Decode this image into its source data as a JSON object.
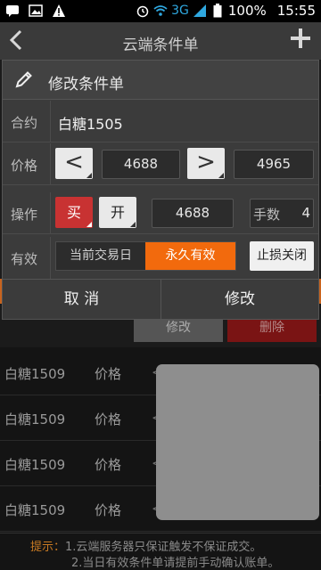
{
  "status_bar": {
    "network": "3G",
    "battery": "100%",
    "time": "15:55"
  },
  "app_bar": {
    "title": "云端条件单"
  },
  "dialog": {
    "title": "修改条件单",
    "contract": {
      "label": "合约",
      "value": "白糖1505"
    },
    "price": {
      "label": "价格",
      "dec": "<",
      "value1": "4688",
      "inc": ">",
      "value2": "4965"
    },
    "operation": {
      "label": "操作",
      "direction": "买",
      "offset": "开",
      "price": "4688",
      "lots_label": "手数",
      "lots": "4"
    },
    "validity": {
      "label": "有效",
      "today": "当前交易日",
      "forever": "永久有效",
      "selected": "永久有效",
      "stoploss": "止损关闭"
    },
    "cancel": "取 消",
    "confirm": "修改"
  },
  "list_actions": {
    "modify": "修改",
    "delete": "删除"
  },
  "list": [
    {
      "name": "白糖1509",
      "field": "价格",
      "symbol": "<"
    },
    {
      "name": "白糖1509",
      "field": "价格",
      "symbol": "<"
    },
    {
      "name": "白糖1509",
      "field": "价格",
      "symbol": "<"
    },
    {
      "name": "白糖1509",
      "field": "价格",
      "symbol": "<"
    }
  ],
  "tips": {
    "header": "提示：",
    "line1": "1.云端服务器只保证触发不保证成交。",
    "line2": "2.当日有效条件单请提前手动确认账单。"
  },
  "colors": {
    "accent_orange": "#f26a0d",
    "buy_red": "#c83232",
    "dialog_bg": "#3b3b3b"
  }
}
